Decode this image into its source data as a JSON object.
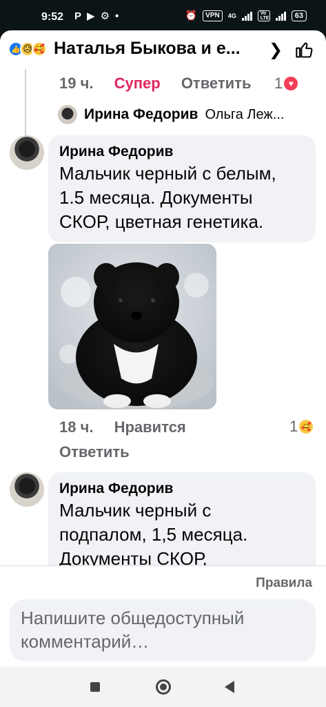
{
  "status_bar": {
    "time": "9:52",
    "network_label": "VPN",
    "signal_label": "4G",
    "volte_label": "Vo LTE",
    "battery": "63"
  },
  "header": {
    "title": "Наталья Быкова и е...",
    "reaction_icons": [
      "like-icon",
      "sad-icon",
      "care-icon"
    ]
  },
  "earlier_comment": {
    "time": "19 ч.",
    "reaction_label": "Супер",
    "reply_label": "Ответить",
    "reaction_count": "1"
  },
  "reply_preview": {
    "name": "Ирина Федорив",
    "snippet": "Ольга Леж..."
  },
  "comments": [
    {
      "name": "Ирина Федорив",
      "lines": [
        "Мальчик черный с белым,",
        "1.5 месяца. Документы",
        "СКОР, цветная генетика."
      ],
      "time": "18 ч.",
      "like_label": "Нравится",
      "reply_label": "Ответить",
      "reaction_count": "1"
    },
    {
      "name": "Ирина Федорив",
      "lines": [
        "Мальчик черный с",
        "подпалом, 1,5 месяца.",
        "Документы СКОР,"
      ]
    }
  ],
  "composer": {
    "rules_label": "Правила",
    "placeholder_lines": [
      "Напишите общедоступный",
      "комментарий…"
    ]
  },
  "colors": {
    "accent_red": "#e0245e",
    "like_blue": "#1877f2",
    "bubble_bg": "#f0f2f5",
    "meta_gray": "#65676b"
  }
}
